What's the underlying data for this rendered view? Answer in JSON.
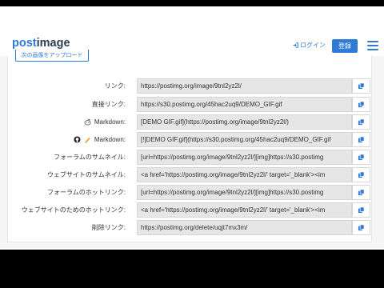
{
  "logo": {
    "part1": "post",
    "part2": "image"
  },
  "nav": {
    "login": "ログイン",
    "register": "登録"
  },
  "upload_more": "次の画像をアップロード",
  "rows": [
    {
      "label": "リンク:",
      "value": "https://postimg.org/image/9tnl2yz2l/"
    },
    {
      "label": "直接リンク:",
      "value": "https://s30.postimg.org/45hac2uq9/DEMO_GIF.gif"
    },
    {
      "label": "Markdown:",
      "value": "[DEMO GIF.gif](https://postimg.org/image/9tnl2yz2l/)"
    },
    {
      "label": "Markdown:",
      "value": "[![DEMO GIF.gif](https://s30.postimg.org/45hac2uq9/DEMO_GIF.gif"
    },
    {
      "label": "フォーラムのサムネイル:",
      "value": "[url=https://postimg.org/image/9tnl2yz2l/][img]https://s30.postimg"
    },
    {
      "label": "ウェブサイトのサムネイル:",
      "value": "<a href='https://postimg.org/image/9tnl2yz2l/' target='_blank'><im"
    },
    {
      "label": "フォーラムのホットリンク:",
      "value": "[url=https://postimg.org/image/9tnl2yz2l/][img]https://s30.postimg"
    },
    {
      "label": "ウェブサイトのためのホットリンク:",
      "value": "<a href='https://postimg.org/image/9tnl2yz2l/' target='_blank'><im"
    },
    {
      "label": "削除リンク:",
      "value": "https://postimg.org/delete/uqjt7mx3m/"
    }
  ],
  "colors": {
    "brand": "#2e7bd6",
    "field_bg": "#e6e6e6"
  },
  "icons": {
    "reddit": "reddit-icon",
    "github": "github-icon",
    "pen": "pen-icon",
    "copy": "copy-icon",
    "login": "login-icon"
  }
}
